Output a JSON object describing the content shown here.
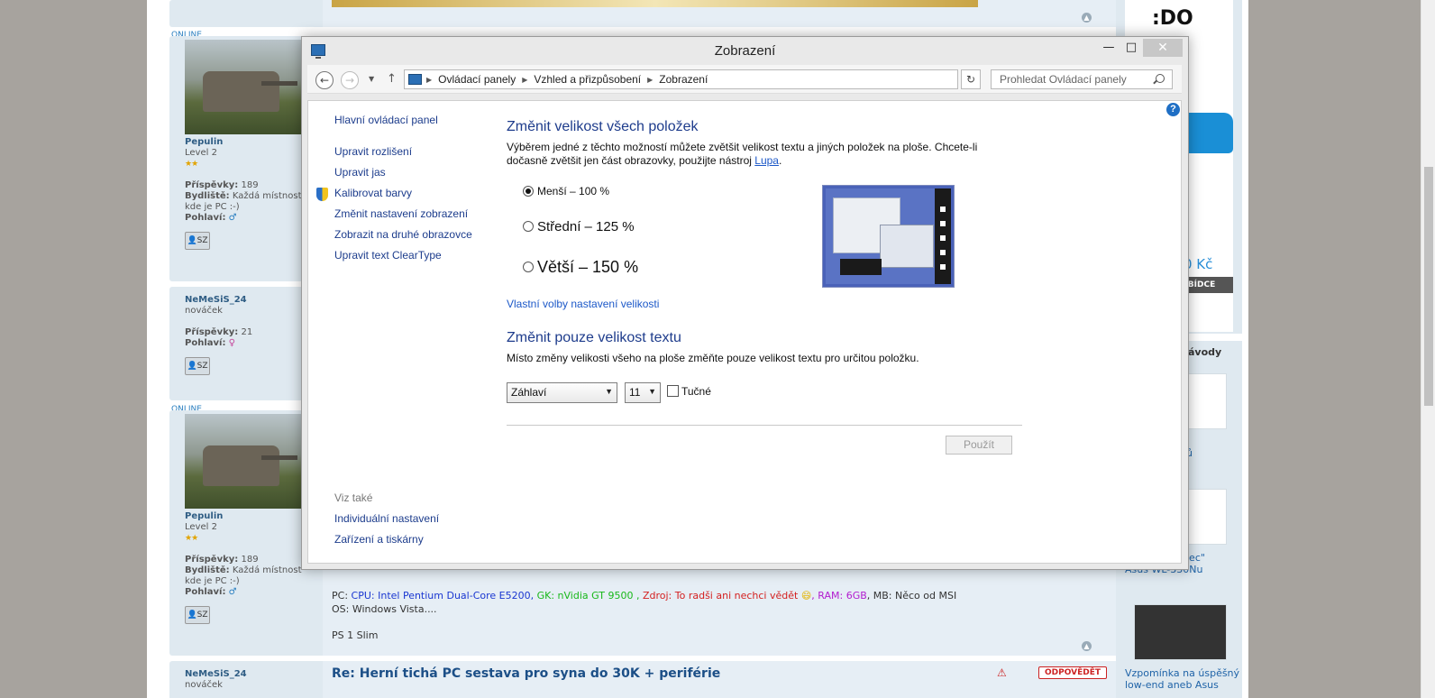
{
  "forum": {
    "online_label": "ONLINE",
    "users": [
      {
        "name": "Pepulin",
        "rank": "Level 2",
        "stars": "★★",
        "posts_label": "Příspěvky:",
        "posts": "189",
        "residence_label": "Bydliště:",
        "residence_line1": "Každá místnost",
        "residence_line2": "kde je PC :-)",
        "gender_label": "Pohlaví:"
      },
      {
        "name": "NeMeSiS_24",
        "rank": "nováček",
        "posts_label": "Příspěvky:",
        "posts": "21",
        "gender_label": "Pohlaví:"
      }
    ],
    "pm_label": "SZ",
    "pc_prefix": "PC:",
    "cpu": "CPU: Intel Pentium Dual-Core E5200,",
    "gk": "GK: nVidia GT 9500 ,",
    "psu": "Zdroj: To radši ani nechci vědět",
    "ram": ", RAM: 6GB",
    "mb": ", MB: Něco od MSI",
    "os": "OS: Windows Vista....",
    "ps": "PS 1 Slim",
    "last_post_title": "Re: Herní tichá PC sestava pro syna do 30K + periférie",
    "reply_label": "ODPOVĚDĚT",
    "colors": {
      "cpu": "#1a37d1",
      "gk": "#18b81a",
      "psu": "#d42020",
      "ram": "#b21ccf"
    }
  },
  "sidebar": {
    "price": "0 Kč",
    "banner_btn": "BÍDCE",
    "contest_heading": "ávody",
    "item1": "ů",
    "item2_line1": "lec\"",
    "item2_line2": "Asus WL-330Nu",
    "item3_line1": "Vzpomínka na úspěšný",
    "item3_line2": "low-end aneb Asus"
  },
  "window": {
    "title": "Zobrazení",
    "breadcrumbs": [
      "Ovládací panely",
      "Vzhled a přizpůsobení",
      "Zobrazení"
    ],
    "search_placeholder": "Prohledat Ovládací panely",
    "help": "?"
  },
  "left_nav": {
    "home": "Hlavní ovládací panel",
    "items": [
      "Upravit rozlišení",
      "Upravit jas",
      "Kalibrovat barvy",
      "Změnit nastavení zobrazení",
      "Zobrazit na druhé obrazovce",
      "Upravit text ClearType"
    ],
    "see_also": "Viz také",
    "see_also_items": [
      "Individuální nastavení",
      "Zařízení a tiskárny"
    ]
  },
  "main": {
    "size_heading": "Změnit velikost všech položek",
    "size_desc_1": "Výběrem jedné z těchto možností můžete zvětšit velikost textu a jiných položek na ploše. Chcete-li dočasně zvětšit jen část obrazovky, použijte nástroj",
    "size_desc_link": "Lupa",
    "size_desc_2": ".",
    "options": [
      {
        "label": "Menší – 100 %",
        "selected": true
      },
      {
        "label": "Střední – 125 %",
        "selected": false
      },
      {
        "label": "Větší – 150 %",
        "selected": false
      }
    ],
    "custom_link": "Vlastní volby nastavení velikosti",
    "text_heading": "Změnit pouze velikost textu",
    "text_desc": "Místo změny velikosti všeho na ploše změňte pouze velikost textu pro určitou položku.",
    "element_select": "Záhlaví",
    "size_select": "11",
    "bold_label": "Tučné",
    "apply_label": "Použít"
  }
}
